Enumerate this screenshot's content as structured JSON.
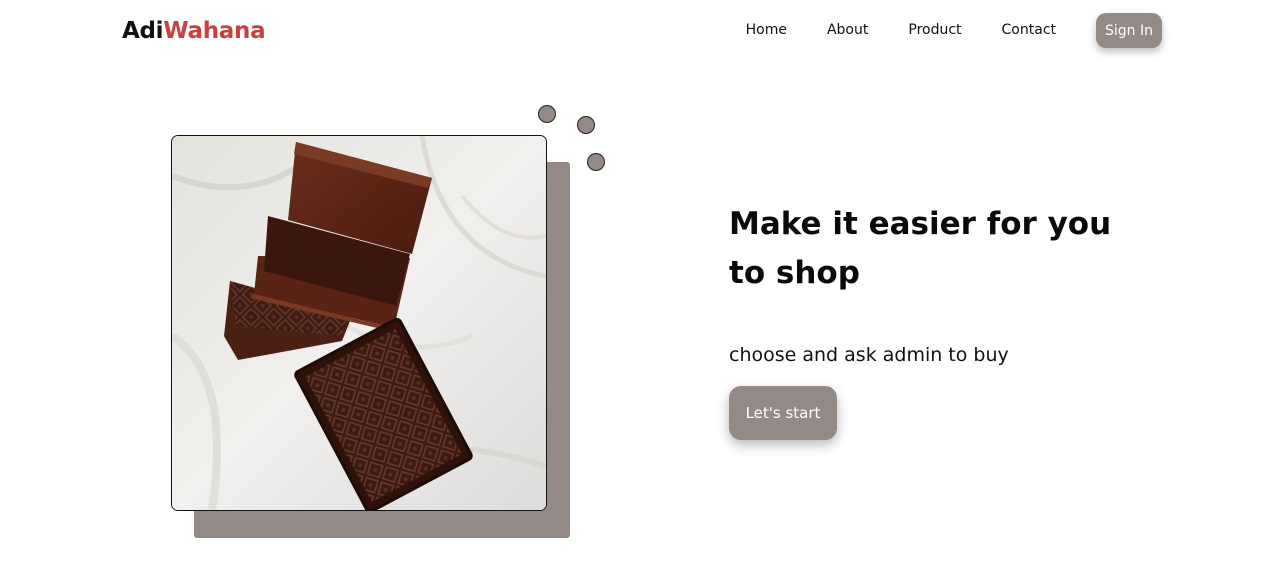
{
  "brand": {
    "part1": "Adi",
    "part2": "Wahana",
    "accent_color": "#c9413f"
  },
  "nav": {
    "items": [
      {
        "label": "Home"
      },
      {
        "label": "About"
      },
      {
        "label": "Product"
      },
      {
        "label": "Contact"
      }
    ],
    "signin_label": "Sign In"
  },
  "hero": {
    "image": "wooden-boxes-photo",
    "headline": "Make it easier for you to shop",
    "subtext": "choose and ask admin to buy",
    "cta_label": "Let's start"
  },
  "colors": {
    "primary_gray": "#938a87",
    "text": "#111111"
  }
}
